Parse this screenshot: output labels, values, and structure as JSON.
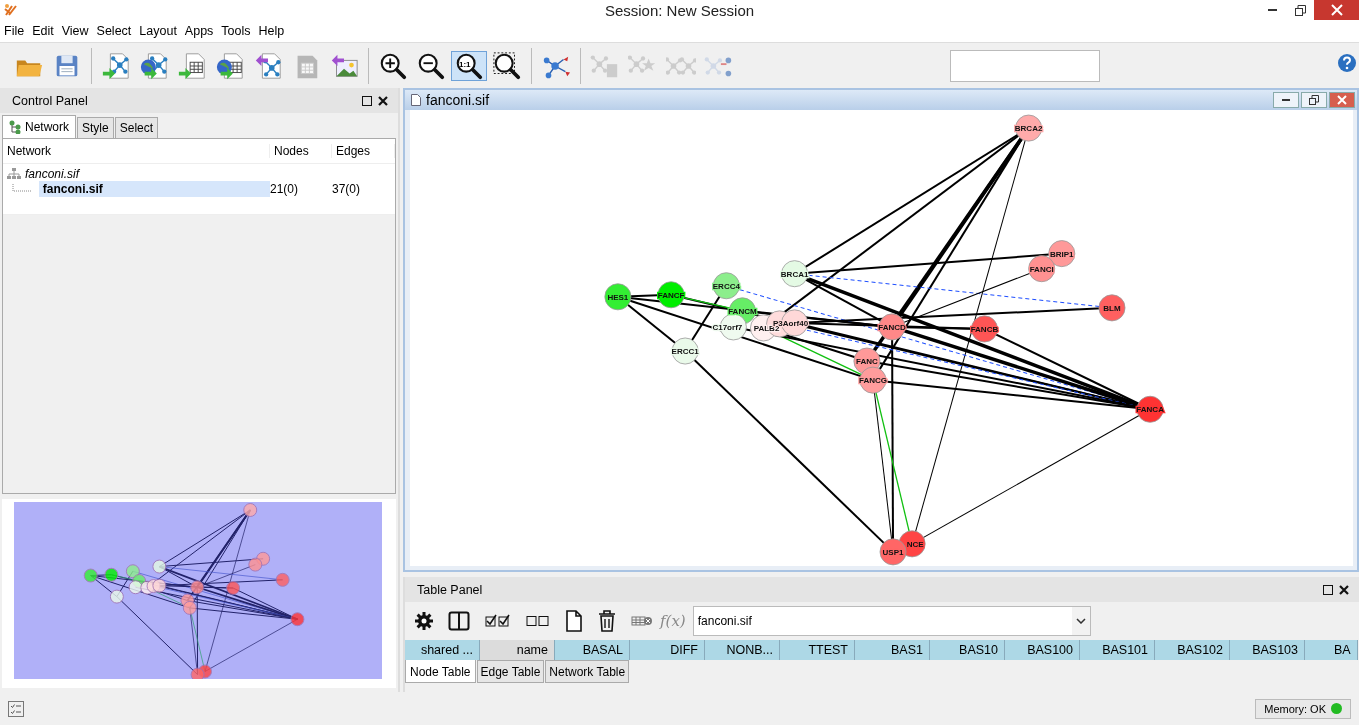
{
  "window": {
    "title": "Session: New Session"
  },
  "menu": [
    "File",
    "Edit",
    "View",
    "Select",
    "Layout",
    "Apps",
    "Tools",
    "Help"
  ],
  "toolbar": [
    {
      "kind": "open",
      "disabled": false
    },
    {
      "kind": "save",
      "disabled": false
    },
    {
      "kind": "separator"
    },
    {
      "kind": "import-network",
      "disabled": false
    },
    {
      "kind": "import-network-web",
      "disabled": false
    },
    {
      "kind": "import-table",
      "disabled": false
    },
    {
      "kind": "import-table-web",
      "disabled": false
    },
    {
      "kind": "export-network",
      "disabled": false
    },
    {
      "kind": "export-table",
      "disabled": true
    },
    {
      "kind": "export-image",
      "disabled": false
    },
    {
      "kind": "separator"
    },
    {
      "kind": "zoom-in",
      "disabled": false,
      "selected": false
    },
    {
      "kind": "zoom-out",
      "disabled": false,
      "selected": false
    },
    {
      "kind": "zoom-actual",
      "label": "1:1",
      "disabled": false,
      "selected": true
    },
    {
      "kind": "zoom-fit",
      "disabled": false,
      "selected": false
    },
    {
      "kind": "separator"
    },
    {
      "kind": "layout",
      "disabled": false
    },
    {
      "kind": "separator"
    },
    {
      "kind": "apply-table",
      "disabled": true
    },
    {
      "kind": "apply-stars",
      "disabled": true
    },
    {
      "kind": "apply-tree",
      "disabled": true
    },
    {
      "kind": "apply-path",
      "disabled": true
    }
  ],
  "control_panel": {
    "title": "Control Panel",
    "tabs": [
      {
        "label": "Network",
        "selected": true
      },
      {
        "label": "Style",
        "selected": false
      },
      {
        "label": "Select",
        "selected": false
      }
    ],
    "columns": [
      "Network",
      "Nodes",
      "Edges"
    ],
    "tree": [
      {
        "label": "fanconi.sif",
        "children": [
          {
            "label": "fanconi.sif",
            "nodes": "21(0)",
            "edges": "37(0)",
            "selected": true
          }
        ]
      }
    ]
  },
  "network_view": {
    "title": "fanconi.sif",
    "nodes": [
      {
        "label": "BRCA2",
        "color": "#ffaaaa"
      },
      {
        "label": "BRIP1",
        "color": "#ff9999"
      },
      {
        "label": "FANCI",
        "color": "#ff9191"
      },
      {
        "label": "BLM",
        "color": "#ff6060"
      },
      {
        "label": "BRCA1",
        "color": "#e4fae4"
      },
      {
        "label": "HES1",
        "color": "#33ee33"
      },
      {
        "label": "FANCF",
        "color": "#00ee00"
      },
      {
        "label": "ERCC4",
        "color": "#8cee8c"
      },
      {
        "label": "FANCM",
        "color": "#66ee66"
      },
      {
        "label": "C17orf7",
        "color": "#effaef"
      },
      {
        "label": "PALB2",
        "color": "#fff0f0"
      },
      {
        "color": "#ffdcdc"
      },
      {
        "label": "P3Aorf40",
        "color": "#ffd8d8"
      },
      {
        "label": "FANCD",
        "color": "#ff8888"
      },
      {
        "label": "FANCB",
        "color": "#ff5555"
      },
      {
        "label": "FANC",
        "color": "#ff9999"
      },
      {
        "label": "FANCG",
        "color": "#ff9c9c"
      },
      {
        "label": "ERCC1",
        "color": "#eafaea"
      },
      {
        "label": "FANCA",
        "color": "#ff3333"
      },
      {
        "label": "NCE",
        "color": "#ff4444"
      },
      {
        "label": "USP1",
        "color": "#ff6666"
      }
    ]
  },
  "table_panel": {
    "title": "Table Panel",
    "tools": [
      {
        "kind": "settings"
      },
      {
        "kind": "split"
      },
      {
        "kind": "check-all"
      },
      {
        "kind": "uncheck-all"
      },
      {
        "kind": "new-table"
      },
      {
        "kind": "delete"
      },
      {
        "kind": "function-builder"
      }
    ],
    "function_label": "f(x)",
    "network_select": "fanconi.sif",
    "columns": [
      {
        "label": "shared ...",
        "selected": false
      },
      {
        "label": "name",
        "selected": true
      },
      {
        "label": "BASAL",
        "selected": false
      },
      {
        "label": "DIFF",
        "selected": false
      },
      {
        "label": "NONB...",
        "selected": false
      },
      {
        "label": "TTEST",
        "selected": false
      },
      {
        "label": "BAS1",
        "selected": false
      },
      {
        "label": "BAS10",
        "selected": false
      },
      {
        "label": "BAS100",
        "selected": false
      },
      {
        "label": "BAS101",
        "selected": false
      },
      {
        "label": "BAS102",
        "selected": false
      },
      {
        "label": "BAS103",
        "selected": false
      },
      {
        "label": "BA",
        "selected": false
      }
    ],
    "tabs": [
      {
        "label": "Node Table",
        "selected": true
      },
      {
        "label": "Edge Table",
        "selected": false
      },
      {
        "label": "Network Table",
        "selected": false
      }
    ]
  },
  "status": {
    "memory": "Memory: OK",
    "memory_ok": true
  }
}
